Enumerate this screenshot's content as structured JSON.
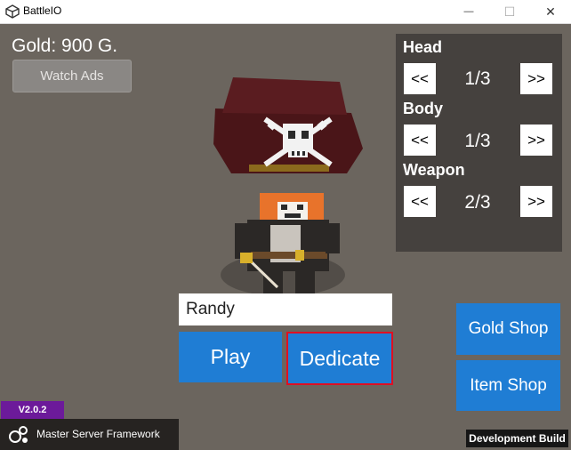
{
  "window": {
    "title": "BattleIO",
    "minimize_glyph": "—",
    "maximize_glyph": "☐",
    "close_glyph": "✕"
  },
  "hud": {
    "gold": "Gold: 900 G.",
    "watch_ads_label": "Watch Ads"
  },
  "customize": {
    "prev_label": "<<",
    "next_label": ">>",
    "rows": [
      {
        "label": "Head",
        "value": "1/3"
      },
      {
        "label": "Body",
        "value": "1/3"
      },
      {
        "label": "Weapon",
        "value": "2/3"
      }
    ]
  },
  "lobby": {
    "player_name": "Randy",
    "play_label": "Play",
    "dedicate_label": "Dedicate"
  },
  "shops": {
    "gold_shop_label": "Gold Shop",
    "item_shop_label": "Item Shop"
  },
  "footer": {
    "version": "V2.0.2",
    "framework": "Master Server Framework",
    "dev_build": "Development Build"
  },
  "icons": {
    "app": "unity-logo-icon",
    "framework": "msf-logo-icon"
  },
  "colors": {
    "background": "#6b655e",
    "panel": "#45413e",
    "button_blue": "#1f7dd4",
    "highlight_border": "#e00f22",
    "version_badge": "#6c1a9a"
  }
}
